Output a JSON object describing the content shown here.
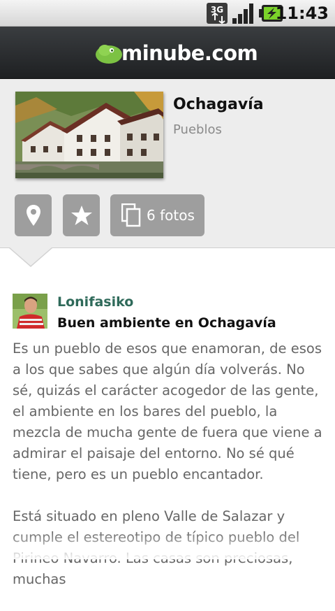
{
  "status_bar": {
    "network": "3G",
    "time": "11:43"
  },
  "header": {
    "logo_text": "minube.com"
  },
  "place": {
    "name": "Ochagavía",
    "category": "Pueblos",
    "photos_button_label": "6 fotos"
  },
  "review": {
    "author": "Lonifasiko",
    "title": "Buen ambiente en Ochagavía",
    "paragraphs": [
      "Es un pueblo de esos que enamoran, de esos a los que sabes que algún día volverás. No sé, quizás el carácter acogedor de las gente, el ambiente en los bares del pueblo, la mezcla de mucha gente de fuera que viene a admirar el paisaje del entorno. No sé qué tiene, pero es un pueblo encantador.",
      "Está situado en pleno Valle de Salazar y cumple el estereotipo de típico pueblo del Pirineo Navarro. Las casas son preciosas, muchas"
    ]
  },
  "icons": {
    "map_button": "map-pin-icon",
    "favorite_button": "star-icon",
    "photos_button": "photos-stack-icon"
  },
  "colors": {
    "brand_green": "#7cc243",
    "author_green": "#2f6a5a",
    "button_gray": "#9e9e9e",
    "panel_bg": "#ededed"
  }
}
